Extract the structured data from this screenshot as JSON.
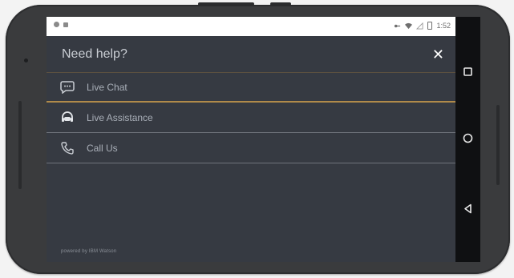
{
  "status_bar": {
    "time": "1:52"
  },
  "header": {
    "title": "Need help?",
    "close_icon": "close-icon"
  },
  "menu": {
    "items": [
      {
        "label": "Live Chat",
        "icon": "chat-bubble-icon",
        "active": true
      },
      {
        "label": "Live Assistance",
        "icon": "headset-icon",
        "active": false
      },
      {
        "label": "Call Us",
        "icon": "phone-icon",
        "active": false
      }
    ]
  },
  "footer": {
    "text": "powered by IBM Watson"
  },
  "colors": {
    "screen_bg": "#363a42",
    "active_underline": "#b08a4a",
    "divider": "#6f747c",
    "text": "#aab0b9"
  }
}
